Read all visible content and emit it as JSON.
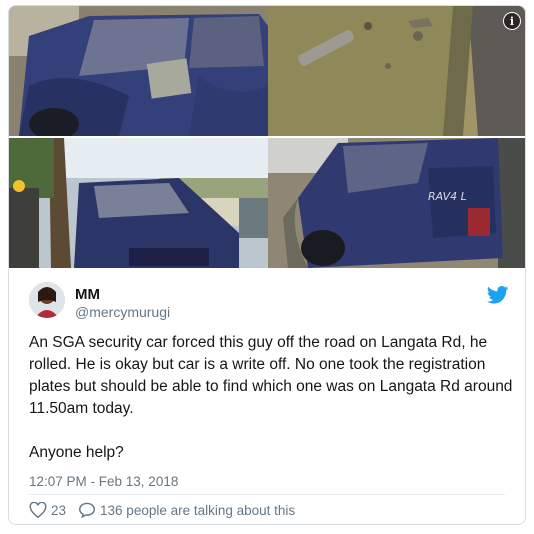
{
  "tweet": {
    "author_name": "MM",
    "author_handle": "@mercymurugi",
    "text": "An SGA security car forced this guy off the road on Langata Rd, he rolled. He is okay but car is a write off. No one took the registration plates but should be able to find which one was on Langata Rd around 11.50am today.\n\nAnyone help?",
    "timestamp": "12:07 PM - Feb 13, 2018",
    "likes": "23",
    "talking": "136 people are talking about this"
  },
  "media": {
    "info_icon": "info-icon",
    "photo_4_badge": "RAV4 L"
  },
  "colors": {
    "twitter_blue": "#1da1f2",
    "text": "#14171a",
    "secondary": "#657786",
    "border": "#d8dde2"
  }
}
